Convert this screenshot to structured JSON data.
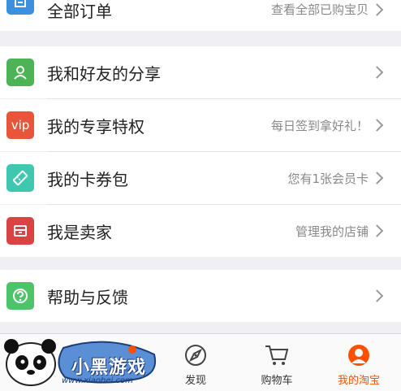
{
  "rows": {
    "all_orders": {
      "label": "全部订单",
      "sub": "查看全部已购宝贝"
    },
    "share": {
      "label": "我和好友的分享"
    },
    "vip": {
      "icon_text": "vip",
      "label": "我的专享特权",
      "sub": "每日签到拿好礼！"
    },
    "coupons": {
      "label": "我的卡券包",
      "sub": "您有1张会员卡"
    },
    "seller": {
      "label": "我是卖家",
      "sub": "管理我的店铺"
    },
    "help": {
      "label": "帮助与反馈"
    }
  },
  "tabbar": {
    "tabs": [
      {
        "label": "发现",
        "icon": "compass-icon"
      },
      {
        "label": "购物车",
        "icon": "cart-icon"
      },
      {
        "label": "我的淘宝",
        "icon": "my-taobao-icon",
        "active": true
      }
    ]
  },
  "watermark": {
    "brand": "小黑游戏",
    "url": "www.xiaohei.com"
  },
  "colors": {
    "orders_icon": "#3d8fe0",
    "share_icon": "#4cb356",
    "vip_icon": "#e8553a",
    "coupon_icon": "#3fc7b0",
    "seller_icon": "#d94343",
    "help_icon": "#4cc46a",
    "active_tab": "#ff5000"
  }
}
